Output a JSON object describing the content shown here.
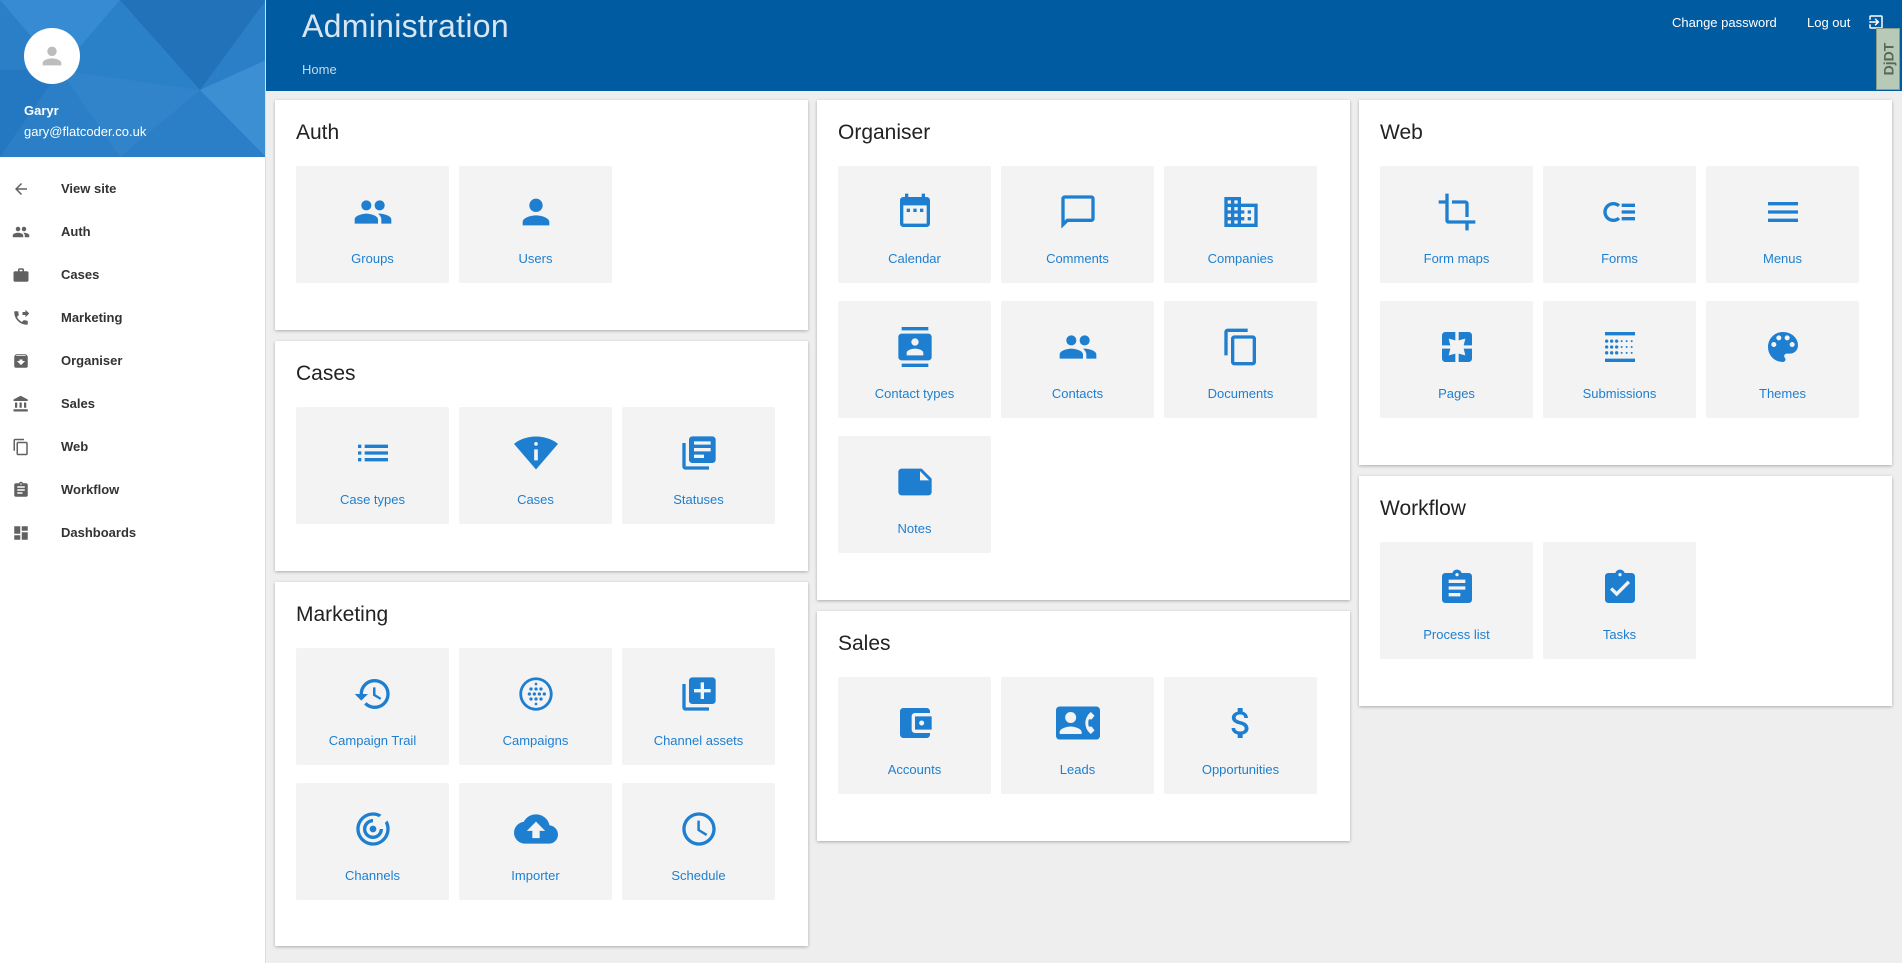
{
  "profile": {
    "name": "Garyr",
    "email": "gary@flatcoder.co.uk"
  },
  "sidebar": {
    "items": [
      {
        "label": "View site",
        "icon": "arrow-back-icon"
      },
      {
        "label": "Auth",
        "icon": "people-icon"
      },
      {
        "label": "Cases",
        "icon": "briefcase-icon"
      },
      {
        "label": "Marketing",
        "icon": "phone-forward-icon"
      },
      {
        "label": "Organiser",
        "icon": "archive-icon"
      },
      {
        "label": "Sales",
        "icon": "bank-icon"
      },
      {
        "label": "Web",
        "icon": "copy-icon"
      },
      {
        "label": "Workflow",
        "icon": "clipboard-icon"
      },
      {
        "label": "Dashboards",
        "icon": "dashboard-icon"
      }
    ]
  },
  "header": {
    "title": "Administration",
    "breadcrumb": "Home",
    "change_password": "Change password",
    "logout": "Log out",
    "debug_badge": "DjDT"
  },
  "colors": {
    "header": "#005ba1",
    "accent": "#1e7fd0",
    "tile": "#f3f3f3"
  },
  "cards": {
    "auth": {
      "title": "Auth",
      "tiles": [
        {
          "label": "Groups",
          "icon": "groups-icon"
        },
        {
          "label": "Users",
          "icon": "user-icon"
        }
      ]
    },
    "cases": {
      "title": "Cases",
      "tiles": [
        {
          "label": "Case types",
          "icon": "list-icon"
        },
        {
          "label": "Cases",
          "icon": "wifi-info-icon"
        },
        {
          "label": "Statuses",
          "icon": "library-books-icon"
        }
      ]
    },
    "marketing": {
      "title": "Marketing",
      "tiles": [
        {
          "label": "Campaign Trail",
          "icon": "history-icon"
        },
        {
          "label": "Campaigns",
          "icon": "dots-circle-icon"
        },
        {
          "label": "Channel assets",
          "icon": "library-add-icon"
        },
        {
          "label": "Channels",
          "icon": "target-icon"
        },
        {
          "label": "Importer",
          "icon": "cloud-upload-icon"
        },
        {
          "label": "Schedule",
          "icon": "clock-icon"
        }
      ]
    },
    "organiser": {
      "title": "Organiser",
      "tiles": [
        {
          "label": "Calendar",
          "icon": "calendar-icon"
        },
        {
          "label": "Comments",
          "icon": "comment-icon"
        },
        {
          "label": "Companies",
          "icon": "building-icon"
        },
        {
          "label": "Contact types",
          "icon": "contact-card-icon"
        },
        {
          "label": "Contacts",
          "icon": "contacts-icon"
        },
        {
          "label": "Documents",
          "icon": "documents-icon"
        },
        {
          "label": "Notes",
          "icon": "note-icon"
        }
      ]
    },
    "sales": {
      "title": "Sales",
      "tiles": [
        {
          "label": "Accounts",
          "icon": "wallet-icon"
        },
        {
          "label": "Leads",
          "icon": "contact-phone-icon"
        },
        {
          "label": "Opportunities",
          "icon": "dollar-icon"
        }
      ]
    },
    "web": {
      "title": "Web",
      "tiles": [
        {
          "label": "Form maps",
          "icon": "crop-icon"
        },
        {
          "label": "Forms",
          "icon": "forms-icon"
        },
        {
          "label": "Menus",
          "icon": "menu-icon"
        },
        {
          "label": "Pages",
          "icon": "pages-icon"
        },
        {
          "label": "Submissions",
          "icon": "submissions-icon"
        },
        {
          "label": "Themes",
          "icon": "palette-icon"
        }
      ]
    },
    "workflow": {
      "title": "Workflow",
      "tiles": [
        {
          "label": "Process list",
          "icon": "process-list-icon"
        },
        {
          "label": "Tasks",
          "icon": "task-check-icon"
        }
      ]
    }
  }
}
